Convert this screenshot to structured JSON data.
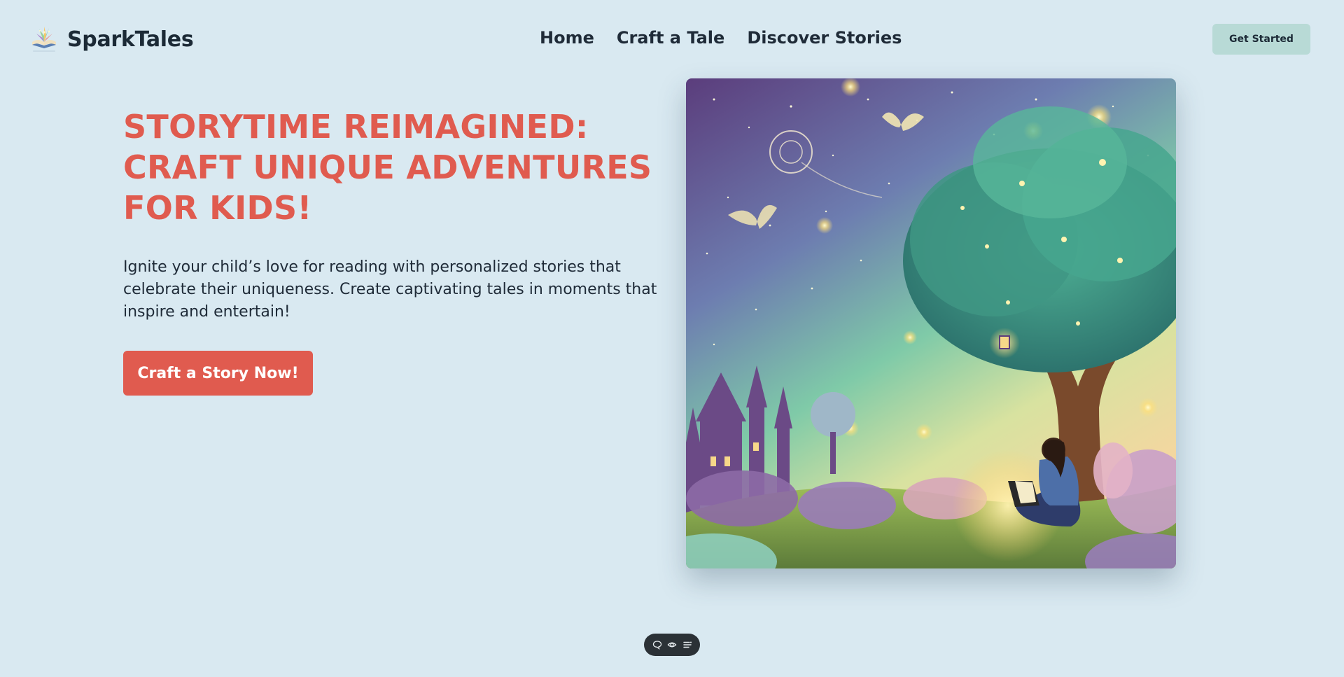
{
  "brand": {
    "name": "SparkTales",
    "logo_icon": "open-book-logo-icon"
  },
  "nav": {
    "items": [
      {
        "label": "Home"
      },
      {
        "label": "Craft a Tale"
      },
      {
        "label": "Discover Stories"
      }
    ]
  },
  "header": {
    "cta_label": "Get Started"
  },
  "hero": {
    "title_lines": [
      "STORYTIME REIMAGINED:",
      "CRAFT UNIQUE ADVENTURES",
      "FOR KIDS!"
    ],
    "subtitle_lines": [
      "Ignite your child’s love for reading with personalized stories that",
      "celebrate their uniqueness. Create captivating tales in moments that",
      "inspire and entertain!"
    ],
    "cta_label": "Craft a Story Now!",
    "illustration_icon": "magical-tree-reading-girl-illustration"
  },
  "toolbar": {
    "icons": [
      "comment-icon",
      "eye-icon",
      "menu-lines-icon"
    ]
  },
  "colors": {
    "background": "#d9e9f1",
    "accent": "#e05b4f",
    "header_button": "#b8dad6",
    "text": "#1c2a36",
    "toolbar": "#2b3136"
  }
}
